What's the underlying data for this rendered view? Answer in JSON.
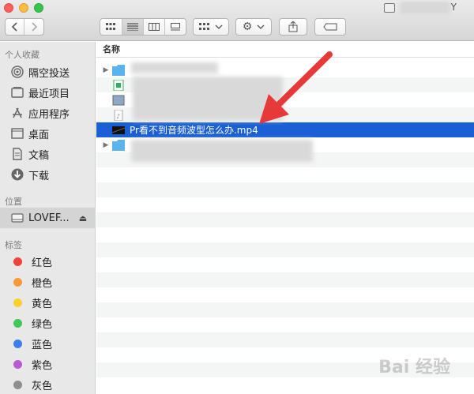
{
  "window": {
    "title": "LOVEFAMILY",
    "title_visible_suffix": "Y"
  },
  "toolbar": {
    "back_icon": "chevron-left-icon",
    "forward_icon": "chevron-right-icon",
    "view_modes": [
      "icon-view",
      "list-view",
      "column-view",
      "gallery-view"
    ],
    "group_label": "group-icon",
    "action_label": "gear-icon",
    "share_label": "share-icon",
    "tag_label": "tag-icon"
  },
  "sidebar": {
    "favorites_title": "个人收藏",
    "favorites": [
      {
        "label": "隔空投送",
        "icon": "airdrop-icon"
      },
      {
        "label": "最近项目",
        "icon": "recents-icon"
      },
      {
        "label": "应用程序",
        "icon": "applications-icon"
      },
      {
        "label": "桌面",
        "icon": "desktop-icon"
      },
      {
        "label": "文稿",
        "icon": "documents-icon"
      },
      {
        "label": "下载",
        "icon": "downloads-icon"
      }
    ],
    "locations_title": "位置",
    "locations": [
      {
        "label": "LOVEF...",
        "icon": "drive-icon"
      }
    ],
    "tags_title": "标签",
    "tags": [
      {
        "label": "红色",
        "color": "#f5413b"
      },
      {
        "label": "橙色",
        "color": "#f99934"
      },
      {
        "label": "黄色",
        "color": "#fcd02a"
      },
      {
        "label": "绿色",
        "color": "#3ec956"
      },
      {
        "label": "蓝色",
        "color": "#3b7ef0"
      },
      {
        "label": "紫色",
        "color": "#b85ad3"
      },
      {
        "label": "灰色",
        "color": "#8e8e8e"
      }
    ]
  },
  "main": {
    "column_header": "名称",
    "files": [
      {
        "name": "Pr看不到音频波型怎么办.mp4",
        "selected": true
      }
    ]
  },
  "watermark": "Bai 经验"
}
